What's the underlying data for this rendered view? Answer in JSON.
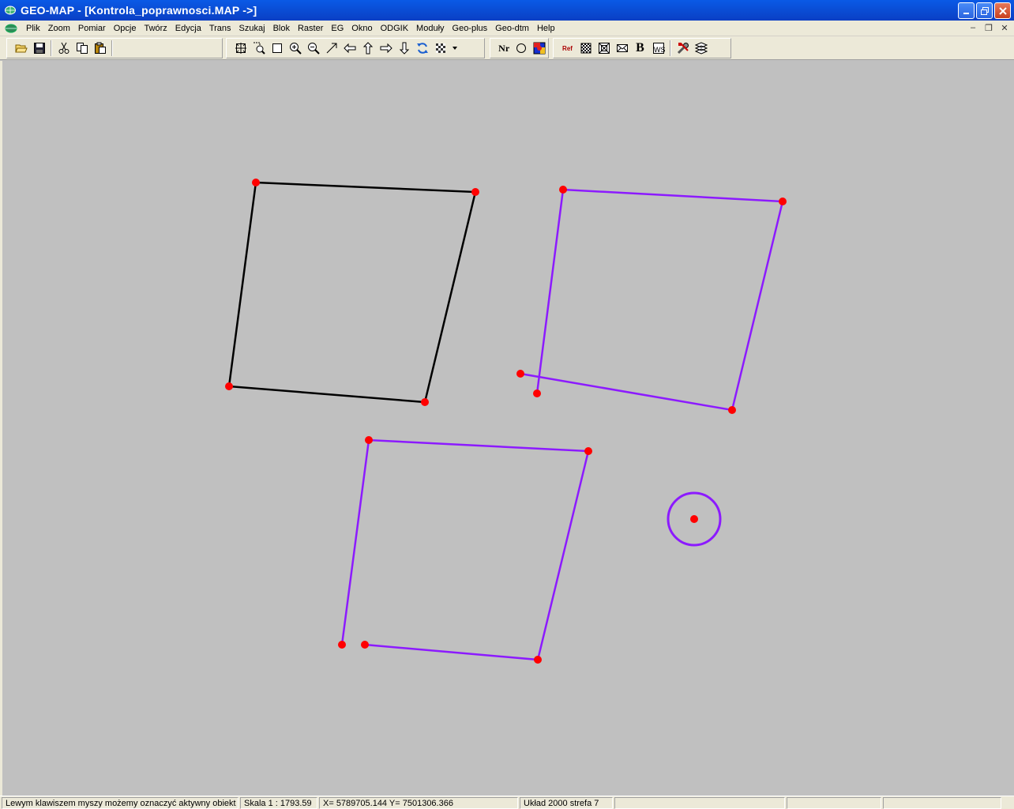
{
  "window": {
    "title": "GEO-MAP - [Kontrola_poprawnosci.MAP ->]",
    "controls": [
      "minimize",
      "restore",
      "close"
    ]
  },
  "menu": {
    "items": [
      "Plik",
      "Zoom",
      "Pomiar",
      "Opcje",
      "Twórz",
      "Edycja",
      "Trans",
      "Szukaj",
      "Blok",
      "Raster",
      "EG",
      "Okno",
      "ODGIK",
      "Moduły",
      "Geo-plus",
      "Geo-dtm",
      "Help"
    ]
  },
  "toolbar": {
    "nr_label": "Nr",
    "ref_label": "Ref",
    "b_label": "B",
    "icons": [
      "open-icon",
      "save-icon",
      "cut-icon",
      "copy-icon",
      "paste-icon",
      "zoom-extents-icon",
      "zoom-window-icon",
      "select-rect-icon",
      "zoom-in-icon",
      "zoom-out-icon",
      "arrow-icon",
      "pan-left-icon",
      "pan-up-icon",
      "pan-right-icon",
      "pan-down-icon",
      "refresh-icon",
      "pattern-icon",
      "nr-icon",
      "circle-icon",
      "color-icon",
      "ref-icon",
      "checker-icon",
      "frame-icon",
      "envelope-icon",
      "bold-icon",
      "ws-icon",
      "tools-icon",
      "layers-icon"
    ]
  },
  "map": {
    "line_color_black": "#000000",
    "line_color_purple": "#8c1aff",
    "vertex_color": "#ff0000",
    "background": "#c0c0c0"
  },
  "status": {
    "hint": "Lewym klawiszem myszy możemy oznaczyć aktywny obiekt",
    "scale": "Skala 1 : 1793.59",
    "coords": "X=  5789705.144  Y=  7501306.366",
    "system": "Układ 2000 strefa 7",
    "extra1": "",
    "extra2": "",
    "extra3": ""
  }
}
